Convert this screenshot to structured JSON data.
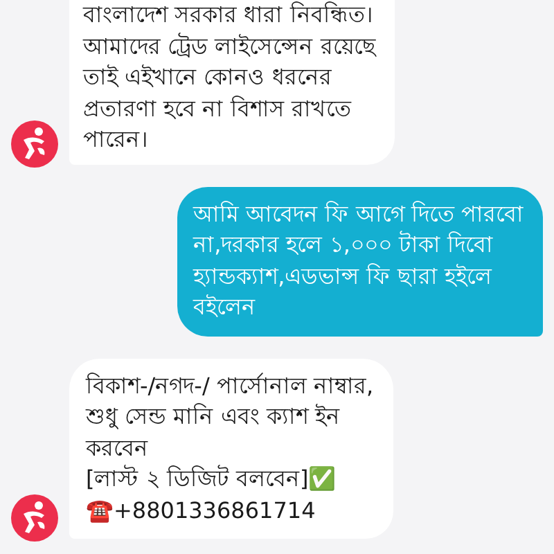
{
  "messages": [
    {
      "kind": "incoming",
      "lines": [
        "বাংলাদেশ সরকার ধারা নিবন্ধিত।",
        "আমাদের ট্রেড লাইসেন্সেন রয়েছে",
        "তাই এইখানে কোনও ধরনের",
        "প্রতারণা হবে না বিশাস রাখতে",
        "পারেন।"
      ]
    },
    {
      "kind": "outgoing",
      "lines": [
        "আমি আবেদন ফি আগে দিতে পারবো",
        "না,দরকার হলে ১,০০০ টাকা দিবো",
        "হ্যান্ডক্যাশ,এডভান্স ফি ছারা হইলে",
        "বইলেন"
      ]
    },
    {
      "kind": "incoming",
      "lines": [
        "বিকাশ-/নগদ-/ পার্সোনাল নাম্বার,",
        "শুধু সেন্ড মানি এবং ক্যাশ ইন",
        "করবেন",
        "[লাস্ট ২ ডিজিট বলবেন]✅",
        "☎️+8801336861714"
      ]
    }
  ]
}
